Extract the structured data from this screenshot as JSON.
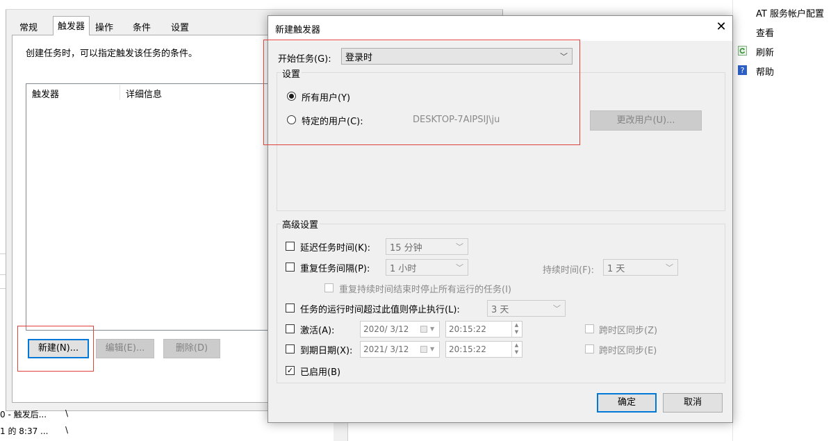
{
  "background_window": {
    "tabs": [
      "常规",
      "触发器",
      "操作",
      "条件",
      "设置"
    ],
    "active_tab_index": 1,
    "description": "创建任务时，可以指定触发该任务的条件。",
    "columns": [
      "触发器",
      "详细信息"
    ],
    "buttons": {
      "new": "新建(N)...",
      "edit": "编辑(E)...",
      "delete": "删除(D)"
    },
    "footer_rows": [
      "0 - 触发后...",
      "1 的 8:37 ..."
    ],
    "footer_slashes": [
      "\\",
      "\\"
    ]
  },
  "right_panel": {
    "items": [
      {
        "label": "AT 服务帐户配置",
        "icon": null
      },
      {
        "label": "查看",
        "icon": null
      },
      {
        "label": "刷新",
        "icon": "refresh-icon"
      },
      {
        "label": "帮助",
        "icon": "help-icon"
      }
    ]
  },
  "dialog": {
    "title": "新建触发器",
    "close_glyph": "✕",
    "begin_task_label": "开始任务(G):",
    "begin_task_value": "登录时",
    "settings_group": "设置",
    "radio_all_users": "所有用户(Y)",
    "radio_specific_user": "特定的用户(C):",
    "specific_user_value": "DESKTOP-7AIPSIJ\\ju",
    "change_user_button": "更改用户(U)...",
    "advanced_group": "高级设置",
    "delay_task": {
      "label": "延迟任务时间(K):",
      "value": "15 分钟",
      "checked": false
    },
    "repeat_task": {
      "label": "重复任务间隔(P):",
      "value": "1 小时",
      "checked": false
    },
    "duration_label": "持续时间(F):",
    "duration_value": "1 天",
    "stop_all_running": "重复持续时间结束时停止所有运行的任务(I)",
    "stop_if_runs_longer": {
      "label": "任务的运行时间超过此值则停止执行(L):",
      "value": "3 天",
      "checked": false
    },
    "activate": {
      "label": "激活(A):",
      "date": "2020/  3/12",
      "time": "20:15:22",
      "sync_label": "跨时区同步(Z)",
      "checked": false
    },
    "expire": {
      "label": "到期日期(X):",
      "date": "2021/  3/12",
      "time": "20:15:22",
      "sync_label": "跨时区同步(E)",
      "checked": false
    },
    "enabled": {
      "label": "已启用(B)",
      "checked": true
    },
    "ok_button": "确定",
    "cancel_button": "取消"
  },
  "colors": {
    "highlight_box": "#e0403a",
    "default_button_border": "#0078d7",
    "dialog_background": "#f0f0f0"
  }
}
